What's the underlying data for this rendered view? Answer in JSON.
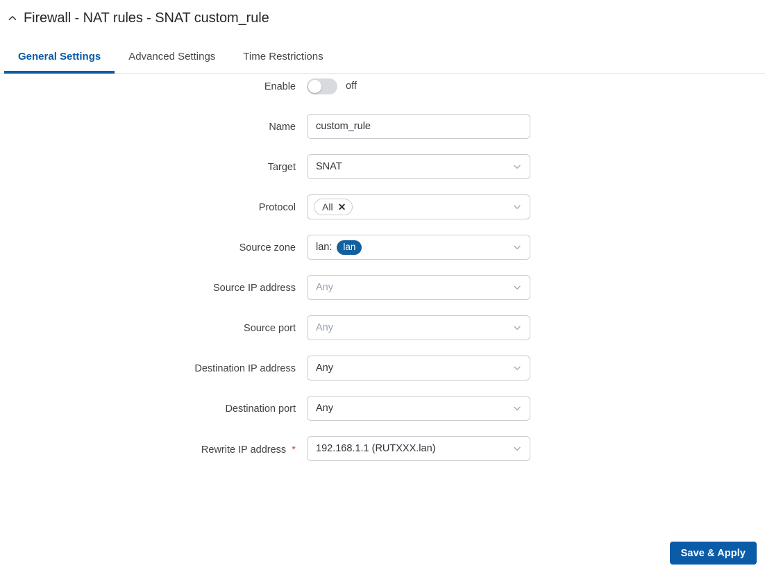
{
  "header": {
    "collapse_icon": "chevron-up-icon",
    "title": "Firewall - NAT rules - SNAT custom_rule"
  },
  "tabs": [
    {
      "label": "General Settings",
      "active": true
    },
    {
      "label": "Advanced Settings",
      "active": false
    },
    {
      "label": "Time Restrictions",
      "active": false
    }
  ],
  "form": {
    "enable": {
      "label": "Enable",
      "state_text": "off",
      "checked": false
    },
    "name": {
      "label": "Name",
      "value": "custom_rule"
    },
    "target": {
      "label": "Target",
      "value": "SNAT"
    },
    "protocol": {
      "label": "Protocol",
      "chip_label": "All",
      "chip_remove": "✕"
    },
    "source_zone": {
      "label": "Source zone",
      "prefix": "lan:",
      "badge": "lan"
    },
    "source_ip": {
      "label": "Source IP address",
      "placeholder": "Any"
    },
    "source_port": {
      "label": "Source port",
      "placeholder": "Any"
    },
    "destination_ip": {
      "label": "Destination IP address",
      "value": "Any"
    },
    "destination_port": {
      "label": "Destination port",
      "value": "Any"
    },
    "rewrite_ip": {
      "label": "Rewrite IP address",
      "required_mark": "*",
      "value": "192.168.1.1 (RUTXXX.lan)"
    }
  },
  "footer": {
    "save_label": "Save & Apply"
  },
  "colors": {
    "accent": "#0a5ca8",
    "badge": "#14609e",
    "required": "#e8432f",
    "border": "#c9ccd2",
    "placeholder": "#97a3b4"
  }
}
